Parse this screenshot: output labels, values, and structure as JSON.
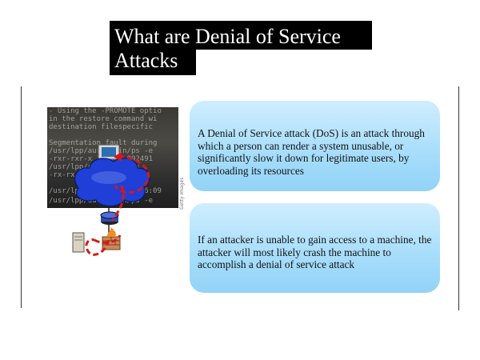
{
  "slide": {
    "title_line1": "What are Denial of Service",
    "title_line2": "Attacks"
  },
  "illustration": {
    "terminal_lines": [
      "- Using the -PROMOTE optio",
      "  in the restore command wi",
      "  destination filespecific",
      "  ",
      "  Segmentation fault during",
      "/usr/lpp/aurar/bin/ps -e",
      "-rxr-rxr-x 1 root 392491",
      "  /usr/lpp/aurar/bin/ps",
      "-rx-rxr-x 1 root 197520",
      "  ",
      "/usr/lpp/aurar/bin/ps  6:09",
      "/usr/lpp/aurar/bin/ps -e"
    ],
    "watermark": "Getty Images",
    "icons": [
      "monitor-icon",
      "network-cloud-icon",
      "router-icon",
      "firewall-icon",
      "server-icon"
    ],
    "attack_path_color": "#d8171a"
  },
  "boxes": {
    "definition": "A Denial of Service attack (DoS) is an attack through which a person can render a system unusable, or significantly slow it down for legitimate users, by overloading its resources",
    "crash": "If an attacker is unable to gain access to a machine, the attacker will most likely crash the machine to accomplish a denial of service attack"
  },
  "colors": {
    "title_bg": "#000000",
    "title_fg": "#ffffff",
    "bubble_top": "#cfeeff",
    "bubble_bottom": "#92d3f7",
    "cloud": "#1f3fd6"
  }
}
